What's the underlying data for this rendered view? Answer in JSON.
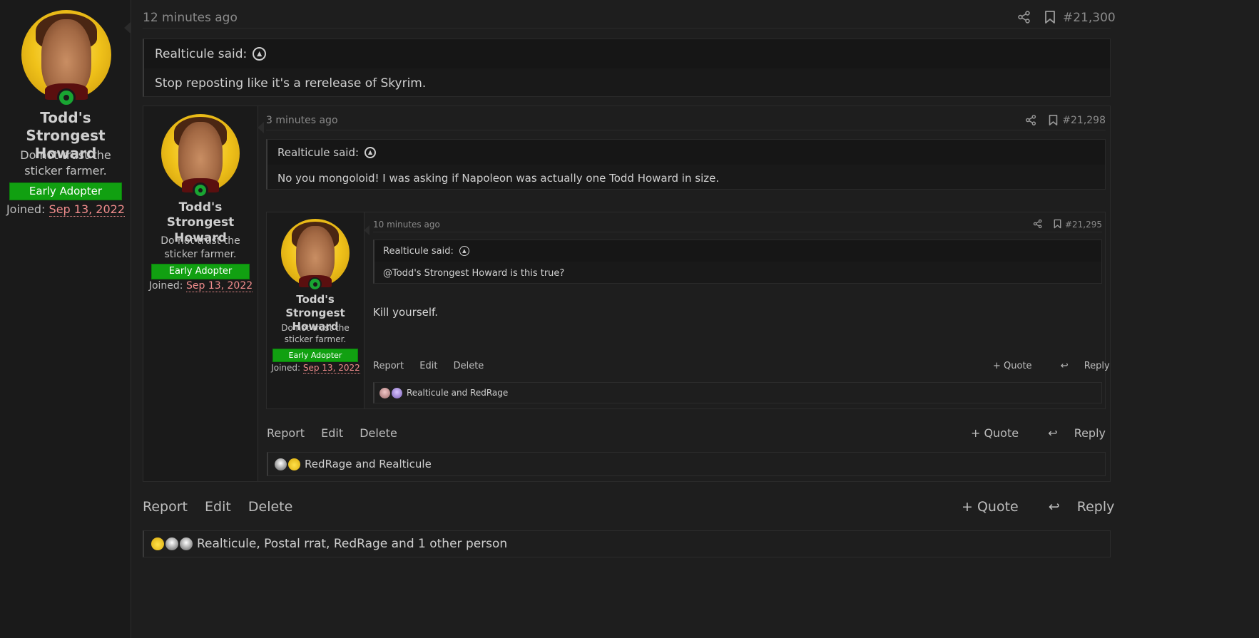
{
  "user": {
    "name": "Todd's Strongest Howard",
    "title": "Do not trust the sticker farmer.",
    "badge": "Early Adopter",
    "joined_label": "Joined:",
    "joined_date": "Sep 13, 2022"
  },
  "colors": {
    "badge": "#11a011",
    "online": "#19a532",
    "date": "#f08c8c",
    "bg": "#1e1e1e"
  },
  "posts": [
    {
      "time": "12 minutes ago",
      "number": "#21,300",
      "quote_author": "Realticule said:",
      "quote_text": "Stop reposting like it's a rerelease of Skyrim.",
      "actions": [
        "Report",
        "Edit",
        "Delete"
      ],
      "quote_btn": "+ Quote",
      "reply_btn": "Reply",
      "reactions": "Realticule, Postal rrat, RedRage and 1 other person"
    },
    {
      "time": "3 minutes ago",
      "number": "#21,298",
      "quote_author": "Realticule said:",
      "quote_text": "No you mongoloid! I was asking if Napoleon was actually one Todd Howard in size.",
      "actions": [
        "Report",
        "Edit",
        "Delete"
      ],
      "quote_btn": "+ Quote",
      "reply_btn": "Reply",
      "reactions": "RedRage and Realticule"
    },
    {
      "time": "10 minutes ago",
      "number": "#21,295",
      "quote_author": "Realticule said:",
      "quote_text": "@Todd's Strongest Howard is this true?",
      "message": "Kill yourself.",
      "actions": [
        "Report",
        "Edit",
        "Delete"
      ],
      "quote_btn": "+ Quote",
      "reply_btn": "Reply",
      "reactions": "Realticule and RedRage"
    }
  ],
  "icons": [
    "share-icon",
    "bookmark-icon",
    "arrow-up-circle-icon",
    "reply-arrow-icon",
    "plus-icon",
    "online-user-icon"
  ]
}
